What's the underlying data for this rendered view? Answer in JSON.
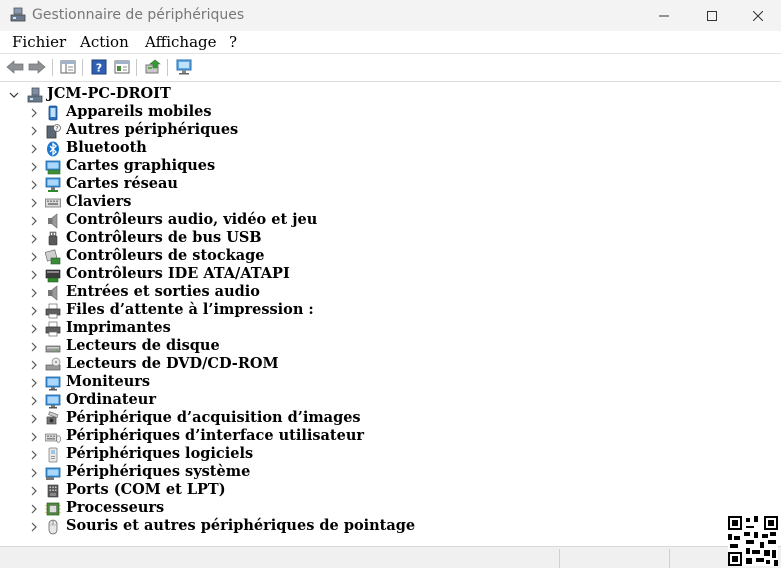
{
  "window": {
    "title": "Gestionnaire de périphériques"
  },
  "menu": {
    "items": [
      {
        "label": "Fichier",
        "name": "menu-fichier"
      },
      {
        "label": "Action",
        "name": "menu-action"
      },
      {
        "label": "Affichage",
        "name": "menu-affichage"
      },
      {
        "label": "?",
        "name": "menu-help"
      }
    ]
  },
  "tree": {
    "root": {
      "label": "JCM-PC-DROIT",
      "icon": "computer-icon"
    },
    "items": [
      {
        "label": "Appareils mobiles",
        "icon": "mobile-device-icon"
      },
      {
        "label": "Autres périphériques",
        "icon": "unknown-device-icon"
      },
      {
        "label": "Bluetooth",
        "icon": "bluetooth-icon"
      },
      {
        "label": "Cartes graphiques",
        "icon": "display-adapter-icon"
      },
      {
        "label": "Cartes réseau",
        "icon": "network-adapter-icon"
      },
      {
        "label": "Claviers",
        "icon": "keyboard-icon"
      },
      {
        "label": "Contrôleurs audio, vidéo et jeu",
        "icon": "speaker-icon"
      },
      {
        "label": "Contrôleurs de bus USB",
        "icon": "usb-icon"
      },
      {
        "label": "Contrôleurs de stockage",
        "icon": "storage-controller-icon"
      },
      {
        "label": "Contrôleurs IDE ATA/ATAPI",
        "icon": "ide-controller-icon"
      },
      {
        "label": "Entrées et sorties audio",
        "icon": "speaker-icon"
      },
      {
        "label": "Files d’attente à l’impression :",
        "icon": "printer-icon"
      },
      {
        "label": "Imprimantes",
        "icon": "printer-icon"
      },
      {
        "label": "Lecteurs de disque",
        "icon": "disk-drive-icon"
      },
      {
        "label": "Lecteurs de DVD/CD-ROM",
        "icon": "dvd-drive-icon"
      },
      {
        "label": "Moniteurs",
        "icon": "monitor-icon"
      },
      {
        "label": "Ordinateur",
        "icon": "monitor-icon"
      },
      {
        "label": "Périphérique d’acquisition d’images",
        "icon": "camera-icon"
      },
      {
        "label": "Périphériques d’interface utilisateur",
        "icon": "hid-icon"
      },
      {
        "label": "Périphériques logiciels",
        "icon": "software-device-icon"
      },
      {
        "label": "Périphériques système",
        "icon": "system-device-icon"
      },
      {
        "label": "Ports (COM et LPT)",
        "icon": "port-icon"
      },
      {
        "label": "Processeurs",
        "icon": "processor-icon"
      },
      {
        "label": "Souris et autres périphériques de pointage",
        "icon": "mouse-icon"
      }
    ]
  },
  "colors": {
    "accent": "#1e7bd6",
    "titlebar": "#f3f3f3"
  }
}
